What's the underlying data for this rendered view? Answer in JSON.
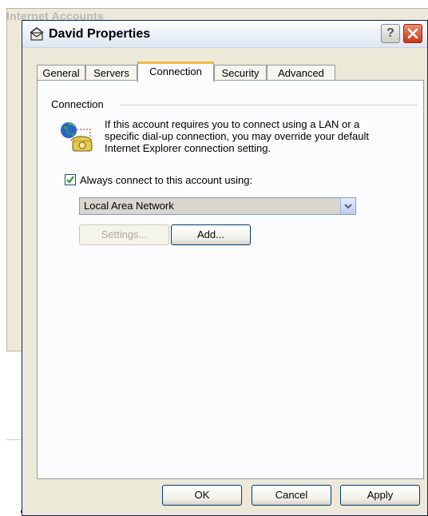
{
  "background_window": {
    "title": "Internet Accounts"
  },
  "dialog": {
    "title": "David Properties",
    "help_label": "?",
    "tabs": [
      {
        "label": "General"
      },
      {
        "label": "Servers"
      },
      {
        "label": "Connection"
      },
      {
        "label": "Security"
      },
      {
        "label": "Advanced"
      }
    ],
    "active_tab": "Connection",
    "connection": {
      "group_label": "Connection",
      "description_lines": [
        "If this account requires you to connect using a LAN or a",
        "specific dial-up connection, you may override your default",
        "Internet Explorer connection setting."
      ],
      "checkbox_label": "Always connect to this account using:",
      "checkbox_checked": true,
      "selected_connection": "Local Area Network",
      "settings_label": "Settings...",
      "add_label": "Add..."
    },
    "buttons": {
      "ok": "OK",
      "cancel": "Cancel",
      "apply": "Apply"
    }
  },
  "colors": {
    "title_close_red": "#c8391b",
    "active_tab_accent": "#f4b946",
    "dialog_face": "#ece9d8",
    "check_green": "#21a121"
  },
  "icons": [
    "account-icon",
    "help-icon",
    "close-icon",
    "globe-phone-icon",
    "checkmark-icon",
    "chevron-down-icon"
  ]
}
